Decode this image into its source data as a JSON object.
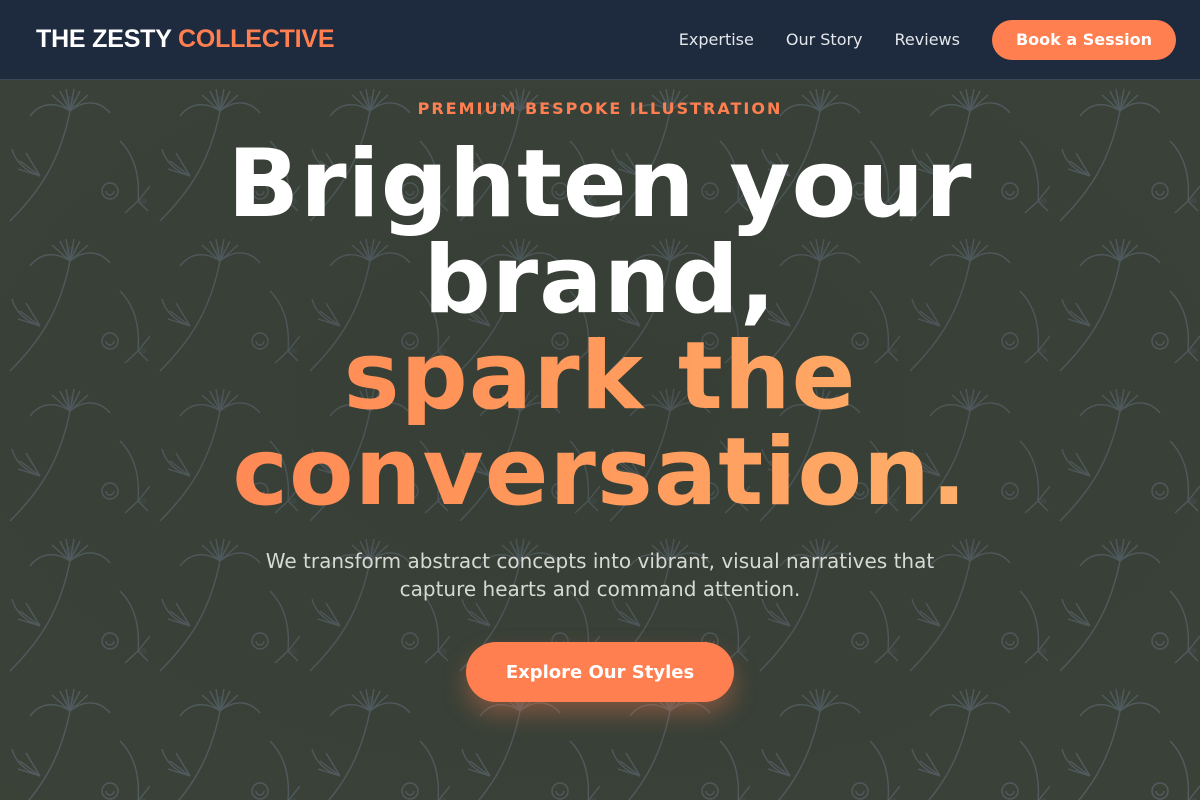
{
  "brand": {
    "name_part1": "THE ZESTY",
    "name_part2": "COLLECTIVE",
    "accent_color": "#ff7f50"
  },
  "nav": {
    "links": [
      {
        "label": "Expertise"
      },
      {
        "label": "Our Story"
      },
      {
        "label": "Reviews"
      }
    ],
    "cta_label": "Book a Session"
  },
  "hero": {
    "eyebrow": "PREMIUM BESPOKE ILLUSTRATION",
    "headline": {
      "line1": "Brighten your",
      "line2": "brand,",
      "line3": "spark the",
      "line4": "conversation."
    },
    "subtitle_line1": "We transform abstract concepts into vibrant, visual narratives that",
    "subtitle_line2": "capture hearts and command attention.",
    "cta_label": "Explore Our Styles",
    "background": "leaf-pattern"
  },
  "colors": {
    "nav_bg": "#1e2a3d",
    "hero_bg": "#3b4339",
    "accent": "#ff7f50",
    "gradient_end": "#ffbb72"
  }
}
